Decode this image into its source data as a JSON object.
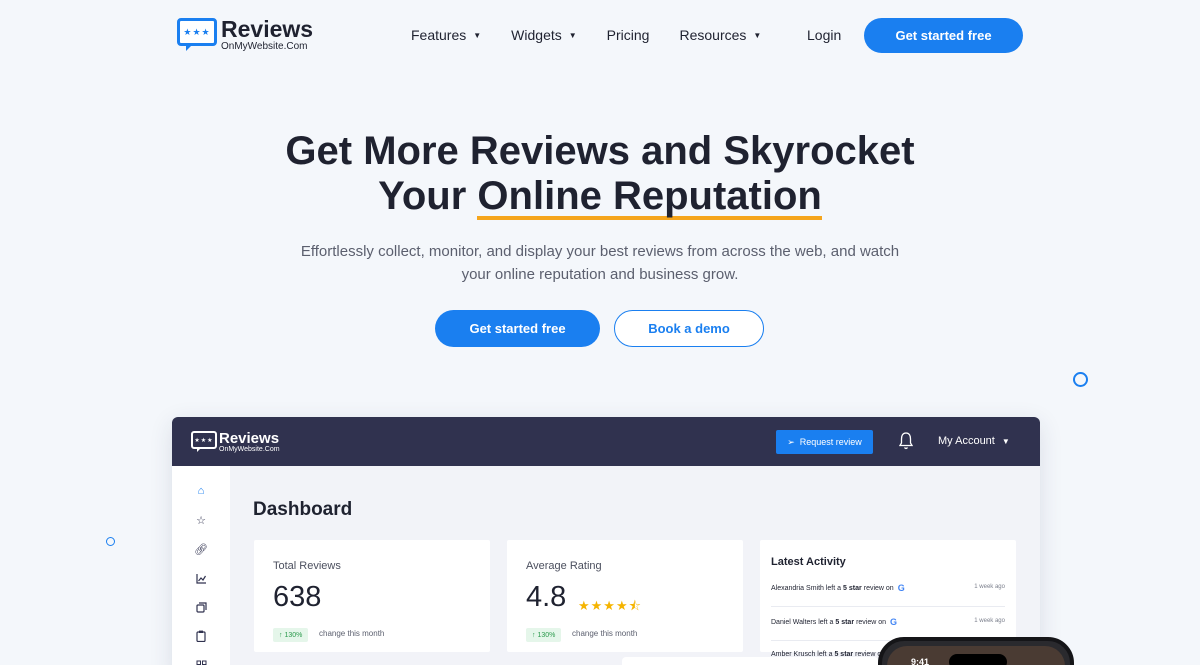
{
  "nav": {
    "logo_title": "Reviews",
    "logo_sub": "OnMyWebsite.Com",
    "logo_stars": "★★★",
    "menu": [
      "Features",
      "Widgets",
      "Pricing",
      "Resources"
    ],
    "login": "Login",
    "cta": "Get started free"
  },
  "hero": {
    "title_line1": "Get More Reviews and Skyrocket",
    "title_line2_prefix": "Your",
    "title_line2_highlight": "Online Reputation",
    "subtitle": "Effortlessly collect, monitor, and display your best reviews from across the web, and watch your online reputation and business grow.",
    "primary_button": "Get started free",
    "secondary_button": "Book a demo"
  },
  "dashboard": {
    "logo_title": "Reviews",
    "logo_sub": "OnMyWebsite.Com",
    "request_button": "Request review",
    "account": "My Account",
    "heading": "Dashboard",
    "total_reviews": {
      "label": "Total Reviews",
      "value": "638",
      "change": "130%",
      "note": "change this month"
    },
    "average_rating": {
      "label": "Average Rating",
      "value": "4.8",
      "stars": "★★★★⯪",
      "change": "130%",
      "note": "change this month"
    },
    "activity": {
      "title": "Latest Activity",
      "rows": [
        {
          "name": "Alexandria Smith left a",
          "stars": "5 star",
          "suffix": "review on",
          "source": "G",
          "time": "1 week ago"
        },
        {
          "name": "Daniel Walters left a",
          "stars": "5 star",
          "suffix": "review on",
          "source": "G",
          "time": "1 week ago"
        },
        {
          "name": "Amber Krusch left a",
          "stars": "5 star",
          "suffix": "review on",
          "source": "",
          "time": ""
        }
      ]
    },
    "phone_time": "9:41"
  },
  "colors": {
    "accent": "#1a7ff0",
    "highlight": "#f5a51c",
    "dash_header": "#30324f"
  }
}
